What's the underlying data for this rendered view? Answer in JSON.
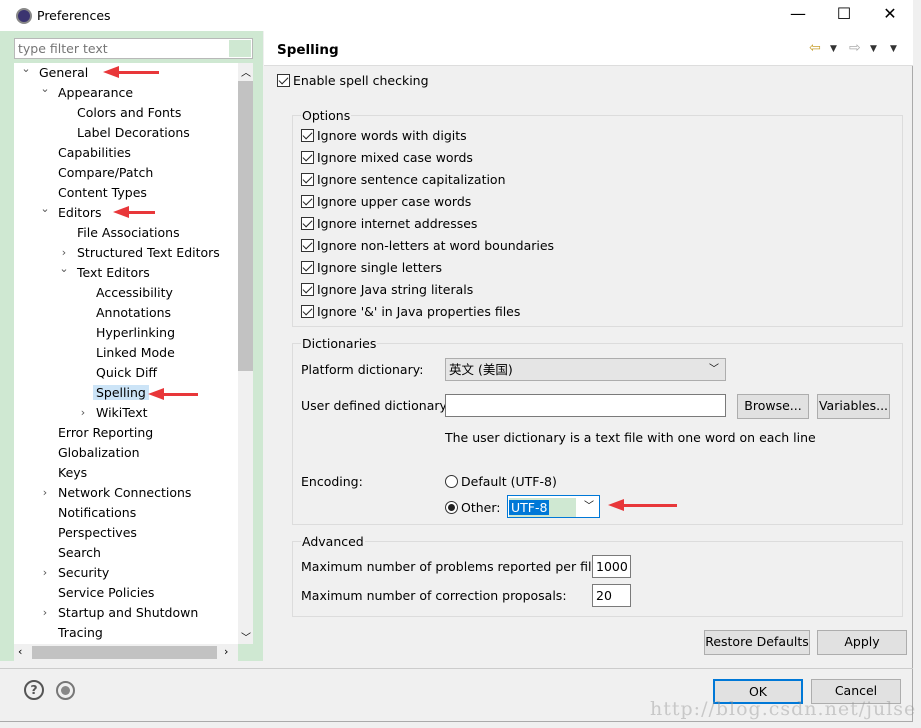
{
  "window": {
    "title": "Preferences",
    "minimize": "—",
    "maximize": "☐",
    "close": "✕"
  },
  "filter": {
    "placeholder": "type filter text"
  },
  "tree": [
    {
      "label": "General",
      "level": 0,
      "chevron": "down"
    },
    {
      "label": "Appearance",
      "level": 1,
      "chevron": "down"
    },
    {
      "label": "Colors and Fonts",
      "level": 2
    },
    {
      "label": "Label Decorations",
      "level": 2
    },
    {
      "label": "Capabilities",
      "level": 1
    },
    {
      "label": "Compare/Patch",
      "level": 1
    },
    {
      "label": "Content Types",
      "level": 1
    },
    {
      "label": "Editors",
      "level": 1,
      "chevron": "down"
    },
    {
      "label": "File Associations",
      "level": 2
    },
    {
      "label": "Structured Text Editors",
      "level": 2,
      "chevron": "right"
    },
    {
      "label": "Text Editors",
      "level": 2,
      "chevron": "down"
    },
    {
      "label": "Accessibility",
      "level": 3
    },
    {
      "label": "Annotations",
      "level": 3
    },
    {
      "label": "Hyperlinking",
      "level": 3
    },
    {
      "label": "Linked Mode",
      "level": 3
    },
    {
      "label": "Quick Diff",
      "level": 3
    },
    {
      "label": "Spelling",
      "level": 3,
      "selected": true
    },
    {
      "label": "WikiText",
      "level": 3,
      "chevron": "right"
    },
    {
      "label": "Error Reporting",
      "level": 1
    },
    {
      "label": "Globalization",
      "level": 1
    },
    {
      "label": "Keys",
      "level": 1
    },
    {
      "label": "Network Connections",
      "level": 1,
      "chevron": "right"
    },
    {
      "label": "Notifications",
      "level": 1
    },
    {
      "label": "Perspectives",
      "level": 1
    },
    {
      "label": "Search",
      "level": 1
    },
    {
      "label": "Security",
      "level": 1,
      "chevron": "right"
    },
    {
      "label": "Service Policies",
      "level": 1
    },
    {
      "label": "Startup and Shutdown",
      "level": 1,
      "chevron": "right"
    },
    {
      "label": "Tracing",
      "level": 1
    }
  ],
  "page": {
    "title": "Spelling",
    "enable": {
      "label": "Enable spell checking",
      "checked": true
    },
    "options": {
      "title": "Options",
      "items": [
        {
          "label": "Ignore words with digits",
          "checked": true
        },
        {
          "label": "Ignore mixed case words",
          "checked": true
        },
        {
          "label": "Ignore sentence capitalization",
          "checked": true
        },
        {
          "label": "Ignore upper case words",
          "checked": true
        },
        {
          "label": "Ignore internet addresses",
          "checked": true
        },
        {
          "label": "Ignore non-letters at word boundaries",
          "checked": true
        },
        {
          "label": "Ignore single letters",
          "checked": true
        },
        {
          "label": "Ignore Java string literals",
          "checked": true
        },
        {
          "label": "Ignore '&' in Java properties files",
          "checked": true
        }
      ]
    },
    "dictionaries": {
      "title": "Dictionaries",
      "platform_label": "Platform dictionary:",
      "platform_value": "英文 (美国)",
      "user_label": "User defined dictionary:",
      "user_value": "",
      "browse": "Browse...",
      "variables": "Variables...",
      "hint": "The user dictionary is a text file with one word on each line",
      "encoding_label": "Encoding:",
      "default_option": "Default (UTF-8)",
      "other_option": "Other:",
      "other_value": "UTF-8",
      "selected": "other"
    },
    "advanced": {
      "title": "Advanced",
      "problems_label": "Maximum number of problems reported per file:",
      "problems_value": "1000",
      "proposals_label": "Maximum number of correction proposals:",
      "proposals_value": "20"
    },
    "restore": "Restore Defaults",
    "apply": "Apply"
  },
  "footer": {
    "ok": "OK",
    "cancel": "Cancel"
  },
  "watermark": "http://blog.csdn.net/julse",
  "colors": {
    "accent": "#0078d7",
    "pane_bg": "#cfe8d2",
    "annotation_arrow": "#e8373a"
  }
}
